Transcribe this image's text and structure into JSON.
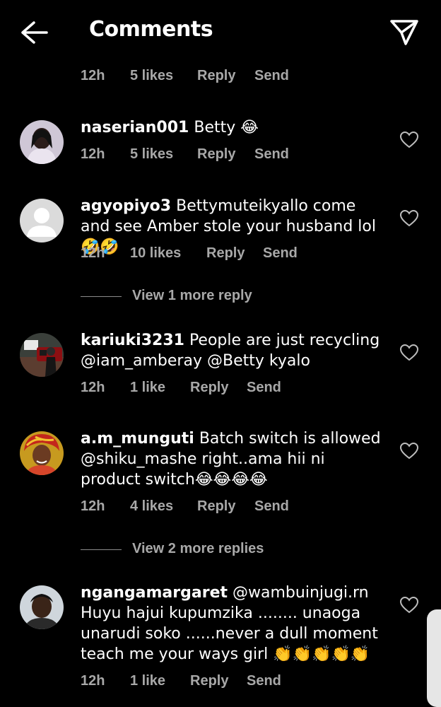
{
  "header": {
    "title": "Comments"
  },
  "top_meta": {
    "time": "12h",
    "likes": "5 likes",
    "reply": "Reply",
    "send": "Send"
  },
  "comments": [
    {
      "username": "naserian001",
      "text": "Betty 😂",
      "time": "12h",
      "likes": "5 likes",
      "reply": "Reply",
      "send": "Send"
    },
    {
      "username": "agyopiyo3",
      "text": "Bettymuteikyallo come and see Amber stole your husband lol🤣🤣",
      "time": "12h",
      "likes": "10 likes",
      "reply": "Reply",
      "send": "Send",
      "view_more": "View 1 more reply"
    },
    {
      "username": "kariuki3231",
      "text": "People are just recycling @iam_amberay @Betty kyalo",
      "time": "12h",
      "likes": "1 like",
      "reply": "Reply",
      "send": "Send"
    },
    {
      "username": "a.m_munguti",
      "text": "Batch switch is allowed @shiku_mashe right..ama hii ni product switch😂😂😂😂",
      "time": "12h",
      "likes": "4 likes",
      "reply": "Reply",
      "send": "Send",
      "view_more": "View 2 more replies"
    },
    {
      "username": "ngangamargaret",
      "text": "@wambuinjugi.rn Huyu hajui kupumzika ........ unaoga unarudi soko ......never a dull moment teach me your ways girl 👏👏👏👏👏",
      "time": "12h",
      "likes": "1 like",
      "reply": "Reply",
      "send": "Send"
    }
  ],
  "icons": {
    "back": "arrow-left-icon",
    "direct": "paper-plane-icon",
    "like": "heart-outline-icon"
  },
  "colors": {
    "background": "#000000",
    "text": "#ffffff",
    "muted": "#a8a8a8"
  }
}
